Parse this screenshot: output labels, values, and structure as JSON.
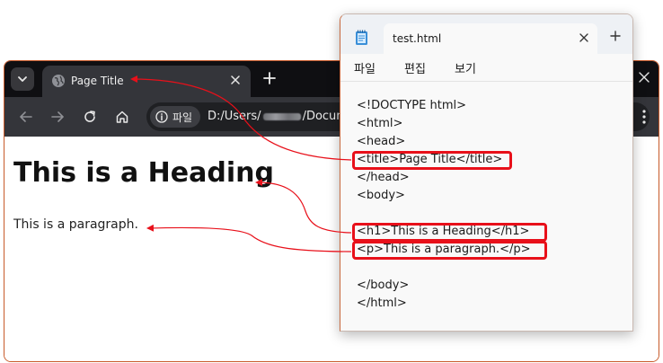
{
  "browser": {
    "tab_title": "Page Title",
    "toolbar": {
      "site_info_label": "파일",
      "url_prefix": "D:/Users/",
      "url_suffix": "/Docum"
    },
    "content": {
      "heading": "This is a Heading",
      "paragraph": "This is a paragraph."
    }
  },
  "notepad": {
    "tab_title": "test.html",
    "menu": [
      "파일",
      "편집",
      "보기"
    ],
    "lines": [
      "<!DOCTYPE html>",
      "<html>",
      "<head>",
      "<title>Page Title</title>",
      "</head>",
      "<body>",
      "",
      "<h1>This is a Heading</h1>",
      "<p>This is a paragraph.</p>",
      "",
      "</body>",
      "</html>"
    ]
  },
  "colors": {
    "annotation": "#e8101a",
    "browser_border": "#c85a2a",
    "browser_tabstrip": "#0f0f12",
    "browser_toolbar": "#34353a"
  },
  "icons": {
    "tab_menu": "chevron-down-icon",
    "tab_favicon": "globe-icon",
    "tab_close": "close-icon",
    "new_tab": "plus-icon",
    "back": "back-arrow-icon",
    "forward": "forward-arrow-icon",
    "reload": "reload-icon",
    "home": "home-icon",
    "site_info": "info-icon",
    "more": "more-vertical-icon",
    "notepad_app": "notepad-icon"
  }
}
